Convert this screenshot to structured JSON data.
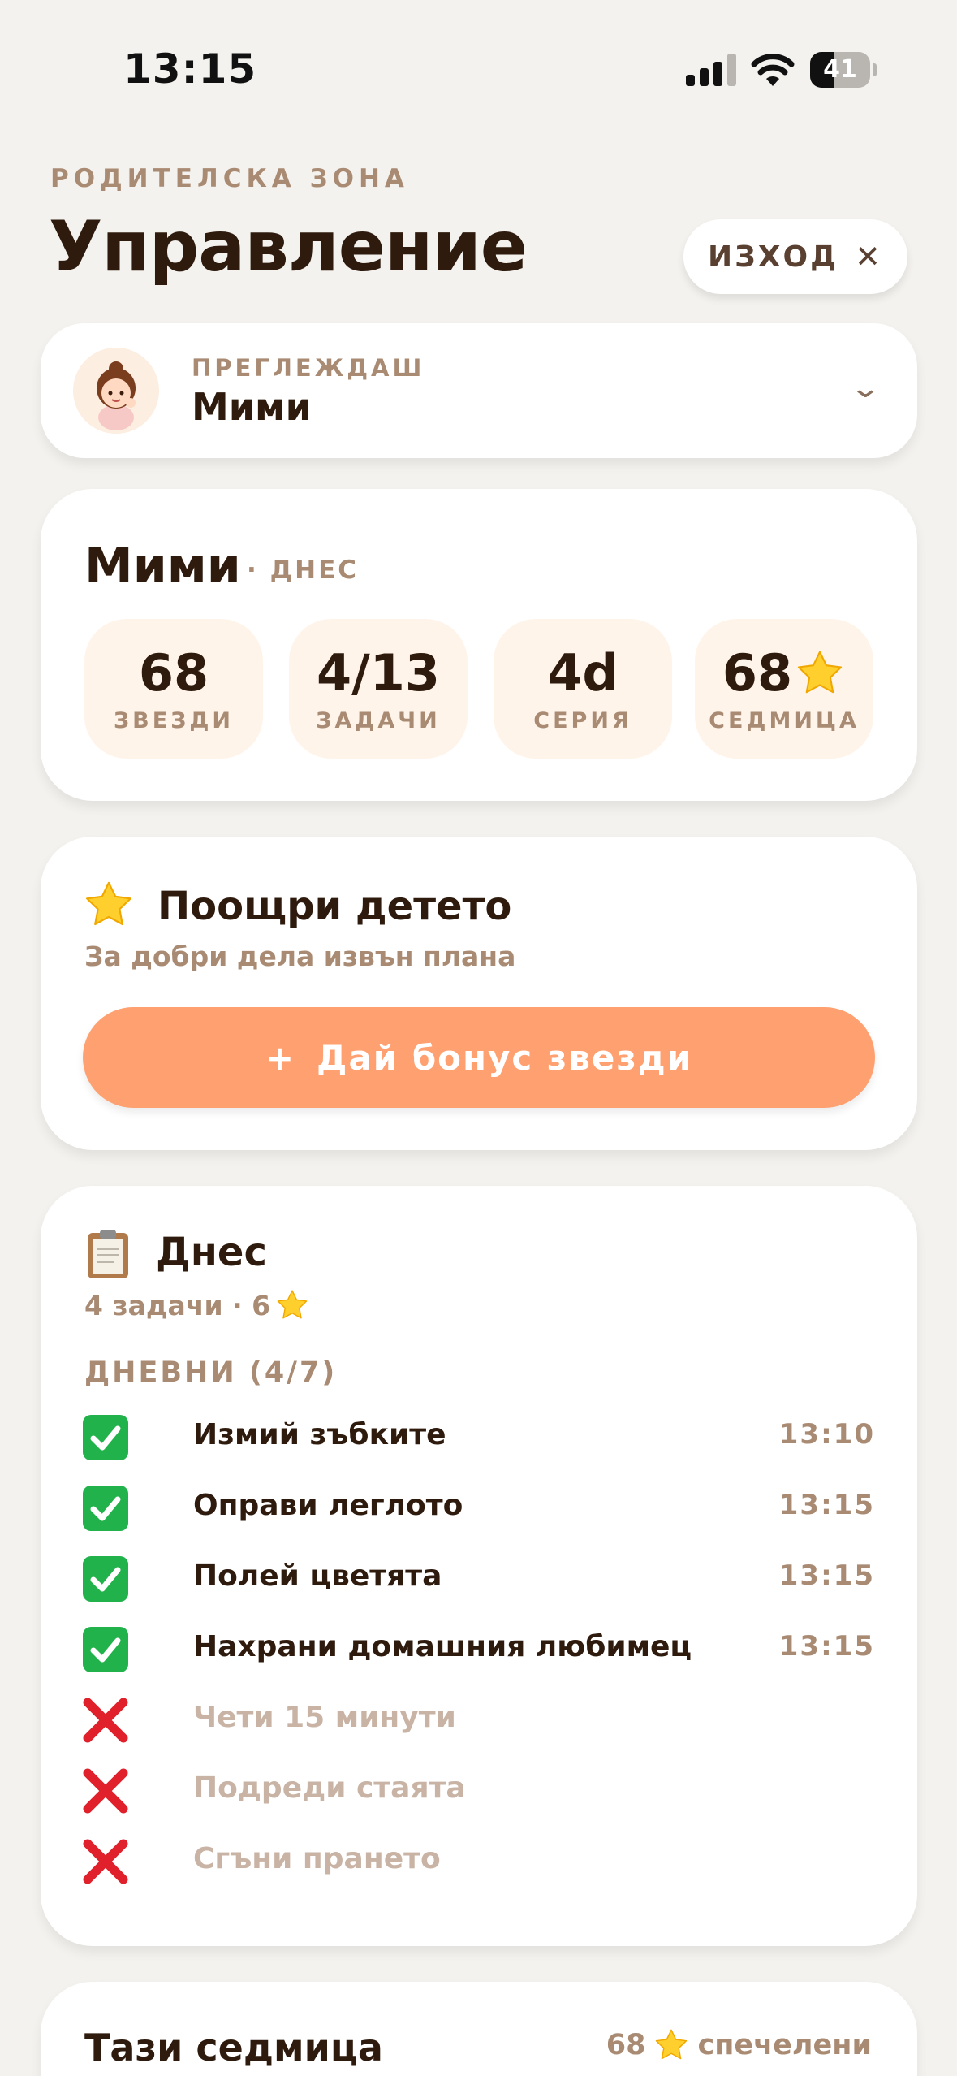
{
  "status_bar": {
    "time": "13:15",
    "battery": "41",
    "battery_level": 0.41
  },
  "header": {
    "eyebrow": "РОДИТЕЛСКА ЗОНА",
    "title": "Управление",
    "exit_label": "ИЗХОД"
  },
  "selector": {
    "label": "ПРЕГЛЕЖДАШ",
    "name": "Мими"
  },
  "summary": {
    "name": "Мими",
    "day_label": "· ДНЕС",
    "stats": [
      {
        "value": "68",
        "label": "ЗВЕЗДИ"
      },
      {
        "value": "4/13",
        "label": "ЗАДАЧИ"
      },
      {
        "value": "4d",
        "label": "СЕРИЯ"
      },
      {
        "value": "68",
        "label": "СЕДМИЦА",
        "icon": "star-icon"
      }
    ]
  },
  "bonus": {
    "title": "Поощри детето",
    "subtitle": "За добри дела извън плана",
    "button_plus": "+",
    "button_label": "Дай бонус звезди"
  },
  "today": {
    "title": "Днес",
    "meta_tasks": "4 задачи · 6",
    "section_label": "ДНЕВНИ (4/7)",
    "tasks": [
      {
        "name": "Измий зъбките",
        "time": "13:10",
        "done": true
      },
      {
        "name": "Оправи леглото",
        "time": "13:15",
        "done": true
      },
      {
        "name": "Полей цветята",
        "time": "13:15",
        "done": true
      },
      {
        "name": "Нахрани домашния любимец",
        "time": "13:15",
        "done": true
      },
      {
        "name": "Чети 15 минути",
        "time": "",
        "done": false
      },
      {
        "name": "Подреди стаята",
        "time": "",
        "done": false
      },
      {
        "name": "Сгъни прането",
        "time": "",
        "done": false
      }
    ]
  },
  "week": {
    "title": "Тази седмица",
    "earned_count": "68",
    "earned_label": "спечелени"
  },
  "colors": {
    "background": "#f4f2ee",
    "accent": "#ffa070",
    "muted": "#a98a72",
    "text": "#2e1b0e",
    "done": "#22b24c",
    "missed": "#e0202a"
  }
}
